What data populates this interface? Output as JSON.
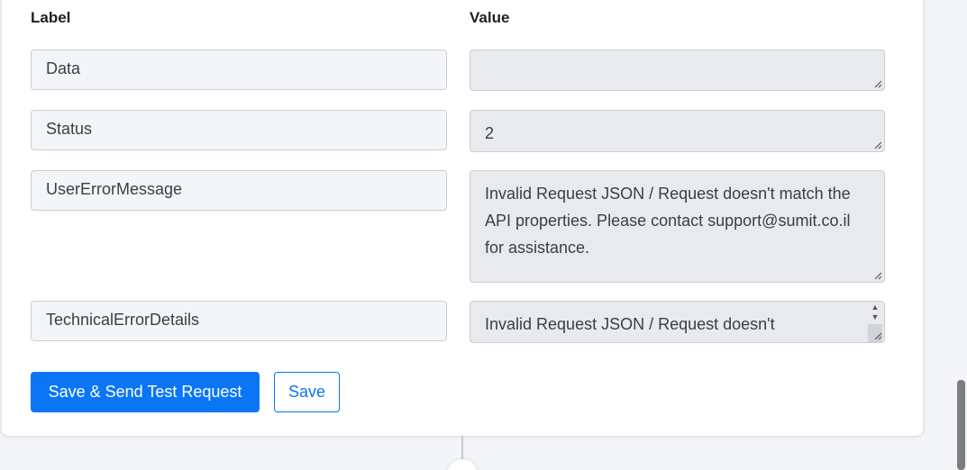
{
  "headers": {
    "label": "Label",
    "value": "Value"
  },
  "rows": [
    {
      "label": "Data",
      "value": ""
    },
    {
      "label": "Status",
      "value": "2"
    },
    {
      "label": "UserErrorMessage",
      "value": "Invalid Request JSON / Request doesn't match the API properties. Please contact support@sumit.co.il for assistance."
    },
    {
      "label": "TechnicalErrorDetails",
      "value": "Invalid Request JSON / Request doesn't"
    }
  ],
  "buttons": {
    "save_send": "Save & Send Test Request",
    "save": "Save"
  },
  "colors": {
    "accent": "#0b76f5",
    "value_bg": "#e8eaed",
    "label_bg": "#f3f5f8"
  }
}
